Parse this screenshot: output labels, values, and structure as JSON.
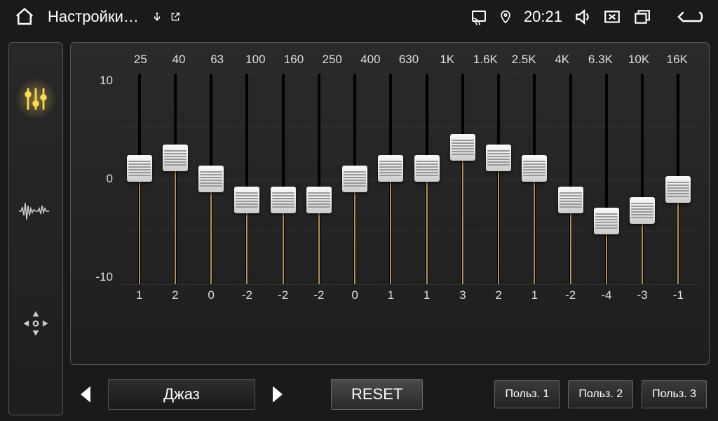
{
  "topbar": {
    "title": "Настройки…",
    "time": "20:21"
  },
  "eq": {
    "freqs": [
      "25",
      "40",
      "63",
      "100",
      "160",
      "250",
      "400",
      "630",
      "1K",
      "1.6K",
      "2.5K",
      "4K",
      "6.3K",
      "10K",
      "16K"
    ],
    "ylabels": [
      "10",
      "0",
      "-10"
    ],
    "values": [
      1,
      2,
      0,
      -2,
      -2,
      -2,
      0,
      1,
      1,
      3,
      2,
      1,
      -2,
      -4,
      -3,
      -1
    ],
    "display_values": [
      "1",
      "2",
      "0",
      "-2",
      "-2",
      "-2",
      "0",
      "1",
      "1",
      "3",
      "2",
      "1",
      "-2",
      "-4",
      "-3",
      "-1"
    ],
    "range": {
      "min": -10,
      "max": 10
    }
  },
  "bottom": {
    "preset": "Джаз",
    "reset": "RESET",
    "users": [
      "Польз. 1",
      "Польз. 2",
      "Польз. 3"
    ]
  }
}
